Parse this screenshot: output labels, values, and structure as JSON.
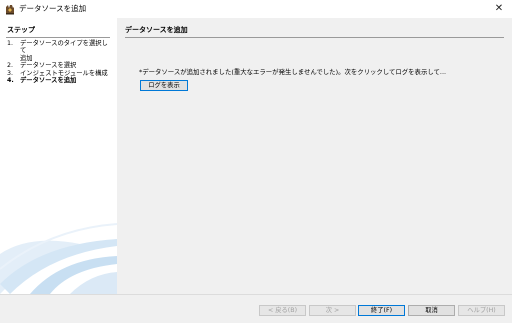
{
  "window": {
    "title": "データソースを追加",
    "close_glyph": "✕",
    "icon": "wizard-app-icon"
  },
  "sidebar": {
    "heading": "ステップ",
    "steps": [
      {
        "number": "1.",
        "label": "データソースのタイプを選択して",
        "label_cont": "追加"
      },
      {
        "number": "2.",
        "label": "データソースを選択"
      },
      {
        "number": "3.",
        "label": "インジェストモジュールを構成"
      },
      {
        "number": "4.",
        "label": "データソースを追加",
        "current": true
      }
    ]
  },
  "content": {
    "heading": "データソースを追加",
    "status_message": "*データソースが追加されました(重大なエラーが発生しませんでした)。次をクリックしてログを表示して...",
    "view_log_label": "ログを表示"
  },
  "footer": {
    "back_label": "< 戻る(B)",
    "next_label": "次 >",
    "finish_label": "終了(F)",
    "cancel_label": "取消",
    "help_label": "ヘルプ(H)"
  },
  "colors": {
    "accent": "#0078d7",
    "panel": "#f0f0f0",
    "sidebar": "#ffffff",
    "decoration": "#cfe3f3"
  }
}
